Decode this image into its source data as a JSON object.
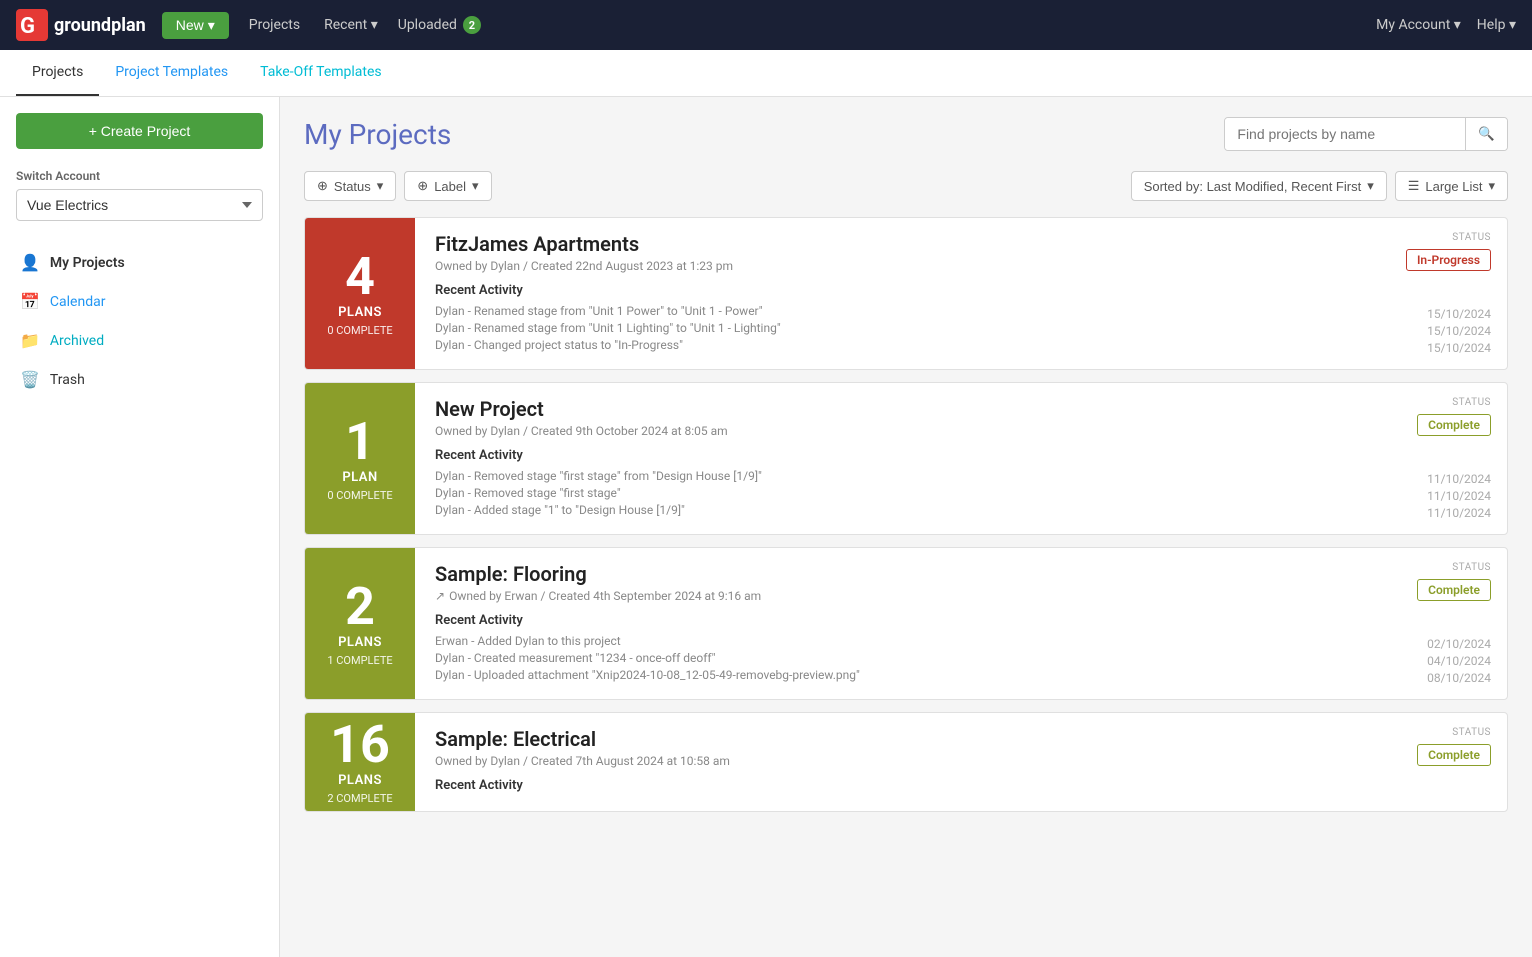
{
  "nav": {
    "logo_text_light": "ground",
    "logo_text_bold": "plan",
    "new_button": "New",
    "projects_link": "Projects",
    "recent_link": "Recent",
    "uploaded_link": "Uploaded",
    "uploaded_count": "2",
    "my_account_link": "My Account",
    "help_link": "Help"
  },
  "sub_nav": {
    "tabs": [
      {
        "label": "Projects",
        "active": true,
        "color": "default"
      },
      {
        "label": "Project Templates",
        "active": false,
        "color": "blue"
      },
      {
        "label": "Take-Off Templates",
        "active": false,
        "color": "teal"
      }
    ]
  },
  "sidebar": {
    "create_btn": "+ Create Project",
    "switch_account_label": "Switch Account",
    "account_name": "Vue Electrics",
    "nav_items": [
      {
        "icon": "👤",
        "label": "My Projects",
        "active": true,
        "color": "default"
      },
      {
        "icon": "📅",
        "label": "Calendar",
        "active": false,
        "color": "blue"
      },
      {
        "icon": "📁",
        "label": "Archived",
        "active": false,
        "color": "teal"
      },
      {
        "icon": "🗑️",
        "label": "Trash",
        "active": false,
        "color": "default"
      }
    ]
  },
  "main": {
    "page_title": "My Projects",
    "search_placeholder": "Find projects by name",
    "filters": {
      "status_btn": "Status",
      "label_btn": "Label"
    },
    "sort": {
      "sorted_by": "Sorted by: Last Modified, Recent First",
      "view": "Large List"
    },
    "projects": [
      {
        "id": "fitzjames",
        "plan_count": "4",
        "plan_unit": "PLANS",
        "plan_complete": "0 COMPLETE",
        "badge_color": "red",
        "name": "FitzJames Apartments",
        "meta": "Owned by Dylan / Created 22nd August 2023 at 1:23 pm",
        "shared": false,
        "status": "In-Progress",
        "status_type": "in-progress",
        "recent_activity_label": "Recent Activity",
        "activities": [
          {
            "text": "Dylan - Renamed stage from \"Unit 1 Power\" to \"Unit 1 - Power\"",
            "date": "15/10/2024"
          },
          {
            "text": "Dylan - Renamed stage from \"Unit 1 Lighting\" to \"Unit 1 - Lighting\"",
            "date": "15/10/2024"
          },
          {
            "text": "Dylan - Changed project status to \"In-Progress\"",
            "date": "15/10/2024"
          }
        ]
      },
      {
        "id": "new-project",
        "plan_count": "1",
        "plan_unit": "PLAN",
        "plan_complete": "0 COMPLETE",
        "badge_color": "olive",
        "name": "New Project",
        "meta": "Owned by Dylan / Created 9th October 2024 at 8:05 am",
        "shared": false,
        "status": "Complete",
        "status_type": "complete",
        "recent_activity_label": "Recent Activity",
        "activities": [
          {
            "text": "Dylan - Removed stage \"first stage\" from \"Design House [1/9]\"",
            "date": "11/10/2024"
          },
          {
            "text": "Dylan - Removed stage \"first stage\"",
            "date": "11/10/2024"
          },
          {
            "text": "Dylan - Added stage \"1\" to \"Design House [1/9]\"",
            "date": "11/10/2024"
          }
        ]
      },
      {
        "id": "sample-flooring",
        "plan_count": "2",
        "plan_unit": "PLANS",
        "plan_complete": "1 COMPLETE",
        "badge_color": "olive",
        "name": "Sample: Flooring",
        "meta": "Owned by Erwan / Created 4th September 2024 at 9:16 am",
        "shared": true,
        "status": "Complete",
        "status_type": "complete",
        "recent_activity_label": "Recent Activity",
        "activities": [
          {
            "text": "Erwan - Added Dylan to this project",
            "date": "02/10/2024"
          },
          {
            "text": "Dylan - Created measurement \"1234 - once-off deoff\"",
            "date": "04/10/2024"
          },
          {
            "text": "Dylan - Uploaded attachment \"Xnip2024-10-08_12-05-49-removebg-preview.png\"",
            "date": "08/10/2024"
          }
        ]
      },
      {
        "id": "sample-electrical",
        "plan_count": "16",
        "plan_unit": "PLANS",
        "plan_complete": "2 COMPLETE",
        "badge_color": "olive",
        "name": "Sample: Electrical",
        "meta": "Owned by Dylan / Created 7th August 2024 at 10:58 am",
        "shared": false,
        "status": "Complete",
        "status_type": "complete",
        "recent_activity_label": "Recent Activity",
        "activities": []
      }
    ]
  },
  "colors": {
    "red_badge": "#c0392b",
    "olive_badge": "#8b9e2a",
    "in_progress_color": "#c0392b",
    "complete_color": "#8b9e2a",
    "title_color": "#5c6bc0",
    "nav_bg": "#1a2035",
    "green_btn": "#4a9f3f"
  }
}
